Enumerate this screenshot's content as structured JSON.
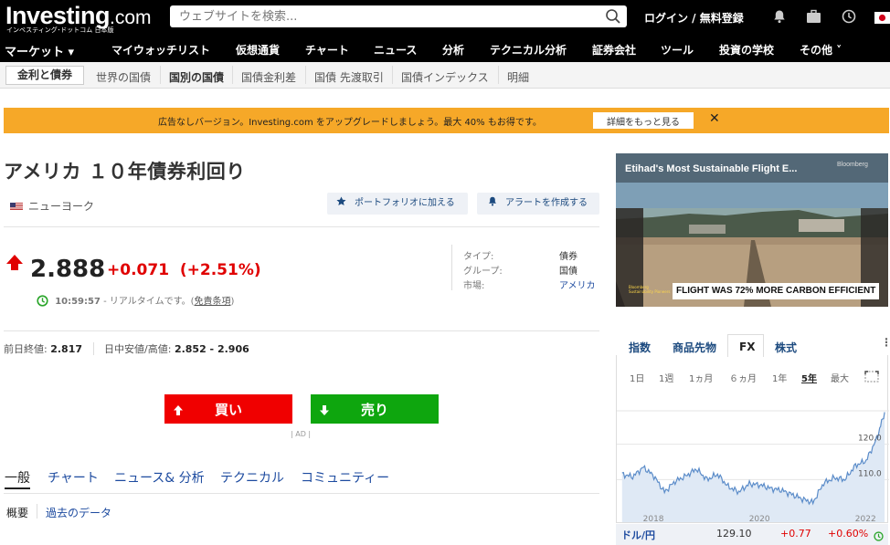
{
  "header": {
    "logo_main": "Investing",
    "logo_suffix": ".com",
    "logo_sub": "インベスティング･ドットコム 日本版",
    "search_placeholder": "ウェブサイトを検索...",
    "login_label": "ログイン / 無料登録"
  },
  "nav": {
    "items": [
      "マーケット ▾",
      "マイウォッチリスト",
      "仮想通貨",
      "チャート",
      "ニュース",
      "分析",
      "テクニカル分析",
      "証券会社",
      "ツール",
      "投資の学校",
      "その他 ˅"
    ]
  },
  "subnav": {
    "items": [
      "金利と債券",
      "世界の国債",
      "国別の国債",
      "国債金利差",
      "国債 先渡取引",
      "国債インデックス",
      "明細"
    ]
  },
  "banner": {
    "text": "広告なしバージョン。Investing.com をアップグレードしましょう。最大 40% もお得です。",
    "button": "詳細をもっと見る",
    "close": "✕"
  },
  "instrument": {
    "title": "アメリカ １０年債券利回り",
    "location": "ニューヨーク",
    "add_portfolio": "ポートフォリオに加える",
    "create_alert": "アラートを作成する",
    "price": "2.888",
    "change": "+0.071",
    "change_pct": "(+2.51%)",
    "time": "10:59:57",
    "time_note": "- リアルタイムです。(",
    "disclaimer": "免責条項",
    "time_close": ")",
    "type_label": "タイプ:",
    "type_value": "債券",
    "group_label": "グループ:",
    "group_value": "国債",
    "market_label": "市場:",
    "market_value": "アメリカ",
    "prev_close_label": "前日終値:",
    "prev_close": "2.817",
    "day_range_label": "日中安値/高値:",
    "day_range": "2.852 - 2.906",
    "buy": "買い",
    "sell": "売り",
    "ad_label": "| AD |"
  },
  "tabs": [
    "一般",
    "チャート",
    "ニュース& 分析",
    "テクニカル",
    "コミュニティー"
  ],
  "subtabs": [
    "概要",
    "過去のデータ"
  ],
  "video": {
    "title": "Etihad's Most Sustainable Flight E...",
    "brand": "Bloomberg",
    "caption": "FLIGHT WAS 72% MORE CARBON EFFICIENT",
    "tag": "Bloomberg Sustainability Pioneers"
  },
  "widget": {
    "tabs": [
      "指数",
      "商品先物",
      "FX",
      "株式"
    ],
    "active_tab": "FX",
    "ranges": [
      "1日",
      "1週",
      "1ヵ月",
      "６ヵ月",
      "1年",
      "5年",
      "最大"
    ],
    "active_range": "5年",
    "pair": "ドル/円",
    "last": "129.10",
    "change": "+0.77",
    "change_pct": "+0.60%"
  },
  "chart_data": {
    "type": "area",
    "title": "",
    "x_tick_labels": [
      "2018",
      "2020",
      "2022"
    ],
    "y_tick_labels": [
      "110.0",
      "120.0"
    ],
    "ylim": [
      100,
      130
    ],
    "grid": true,
    "x": [
      2017.4,
      2017.6,
      2017.8,
      2018.0,
      2018.2,
      2018.4,
      2018.6,
      2018.8,
      2019.0,
      2019.2,
      2019.4,
      2019.6,
      2019.8,
      2020.0,
      2020.2,
      2020.4,
      2020.6,
      2020.8,
      2021.0,
      2021.2,
      2021.4,
      2021.6,
      2021.8,
      2022.0,
      2022.2,
      2022.35
    ],
    "values": [
      111.5,
      110.8,
      113.5,
      111.0,
      106.5,
      109.5,
      111.0,
      113.0,
      110.0,
      111.5,
      108.0,
      106.5,
      108.8,
      108.5,
      107.5,
      107.0,
      105.8,
      104.5,
      103.5,
      109.0,
      110.5,
      110.0,
      114.0,
      115.3,
      121.5,
      129.1
    ],
    "colors": {
      "line": "#5b8cc9",
      "fill": "#dfe9f5"
    }
  },
  "colors": {
    "accent_red": "#e00000",
    "buy": "#f00000",
    "sell": "#0ea60e",
    "banner": "#f6a828",
    "link": "#1c4a9f"
  }
}
